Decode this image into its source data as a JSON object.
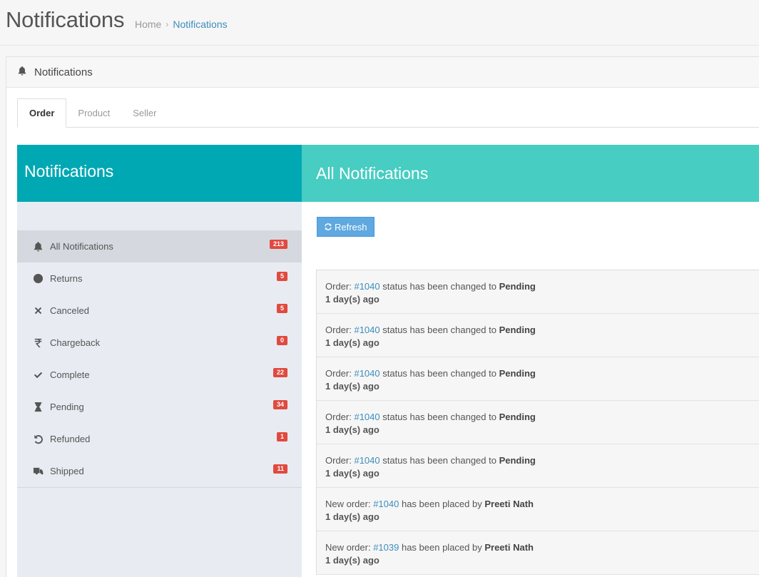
{
  "header": {
    "title": "Notifications",
    "breadcrumb": {
      "home": "Home",
      "separator": "›",
      "current": "Notifications"
    }
  },
  "portlet": {
    "title": "Notifications",
    "icon": "bell-icon"
  },
  "tabs": [
    {
      "label": "Order",
      "active": true
    },
    {
      "label": "Product",
      "active": false
    },
    {
      "label": "Seller",
      "active": false
    }
  ],
  "left_panel": {
    "title": "Notifications",
    "items": [
      {
        "label": "All Notifications",
        "count": "213",
        "icon": "bell-icon",
        "active": true
      },
      {
        "label": "Returns",
        "count": "5",
        "icon": "arrow-circle-left-icon"
      },
      {
        "label": "Canceled",
        "count": "5",
        "icon": "close-icon"
      },
      {
        "label": "Chargeback",
        "count": "0",
        "icon": "rupee-icon"
      },
      {
        "label": "Complete",
        "count": "22",
        "icon": "check-icon"
      },
      {
        "label": "Pending",
        "count": "34",
        "icon": "hourglass-icon"
      },
      {
        "label": "Refunded",
        "count": "1",
        "icon": "undo-icon"
      },
      {
        "label": "Shipped",
        "count": "11",
        "icon": "truck-icon"
      }
    ]
  },
  "right_panel": {
    "title": "All Notifications",
    "refresh_label": "Refresh",
    "notifications": [
      {
        "prefix": "Order: ",
        "link": "#1040",
        "middle": " status has been changed to ",
        "bold": "Pending",
        "time": "1 day(s) ago"
      },
      {
        "prefix": "Order: ",
        "link": "#1040",
        "middle": " status has been changed to ",
        "bold": "Pending",
        "time": "1 day(s) ago"
      },
      {
        "prefix": "Order: ",
        "link": "#1040",
        "middle": " status has been changed to ",
        "bold": "Pending",
        "time": "1 day(s) ago"
      },
      {
        "prefix": "Order: ",
        "link": "#1040",
        "middle": " status has been changed to ",
        "bold": "Pending",
        "time": "1 day(s) ago"
      },
      {
        "prefix": "Order: ",
        "link": "#1040",
        "middle": " status has been changed to ",
        "bold": "Pending",
        "time": "1 day(s) ago"
      },
      {
        "prefix": "New order: ",
        "link": "#1040",
        "middle": " has been placed by ",
        "bold": "Preeti Nath",
        "time": "1 day(s) ago"
      },
      {
        "prefix": "New order: ",
        "link": "#1039",
        "middle": " has been placed by ",
        "bold": "Preeti Nath",
        "time": "1 day(s) ago"
      }
    ]
  },
  "colors": {
    "left_header": "#00a8b3",
    "right_header": "#47cdc2",
    "badge": "#e04a3f",
    "link": "#3c8dbc",
    "button": "#5fa8e0"
  }
}
